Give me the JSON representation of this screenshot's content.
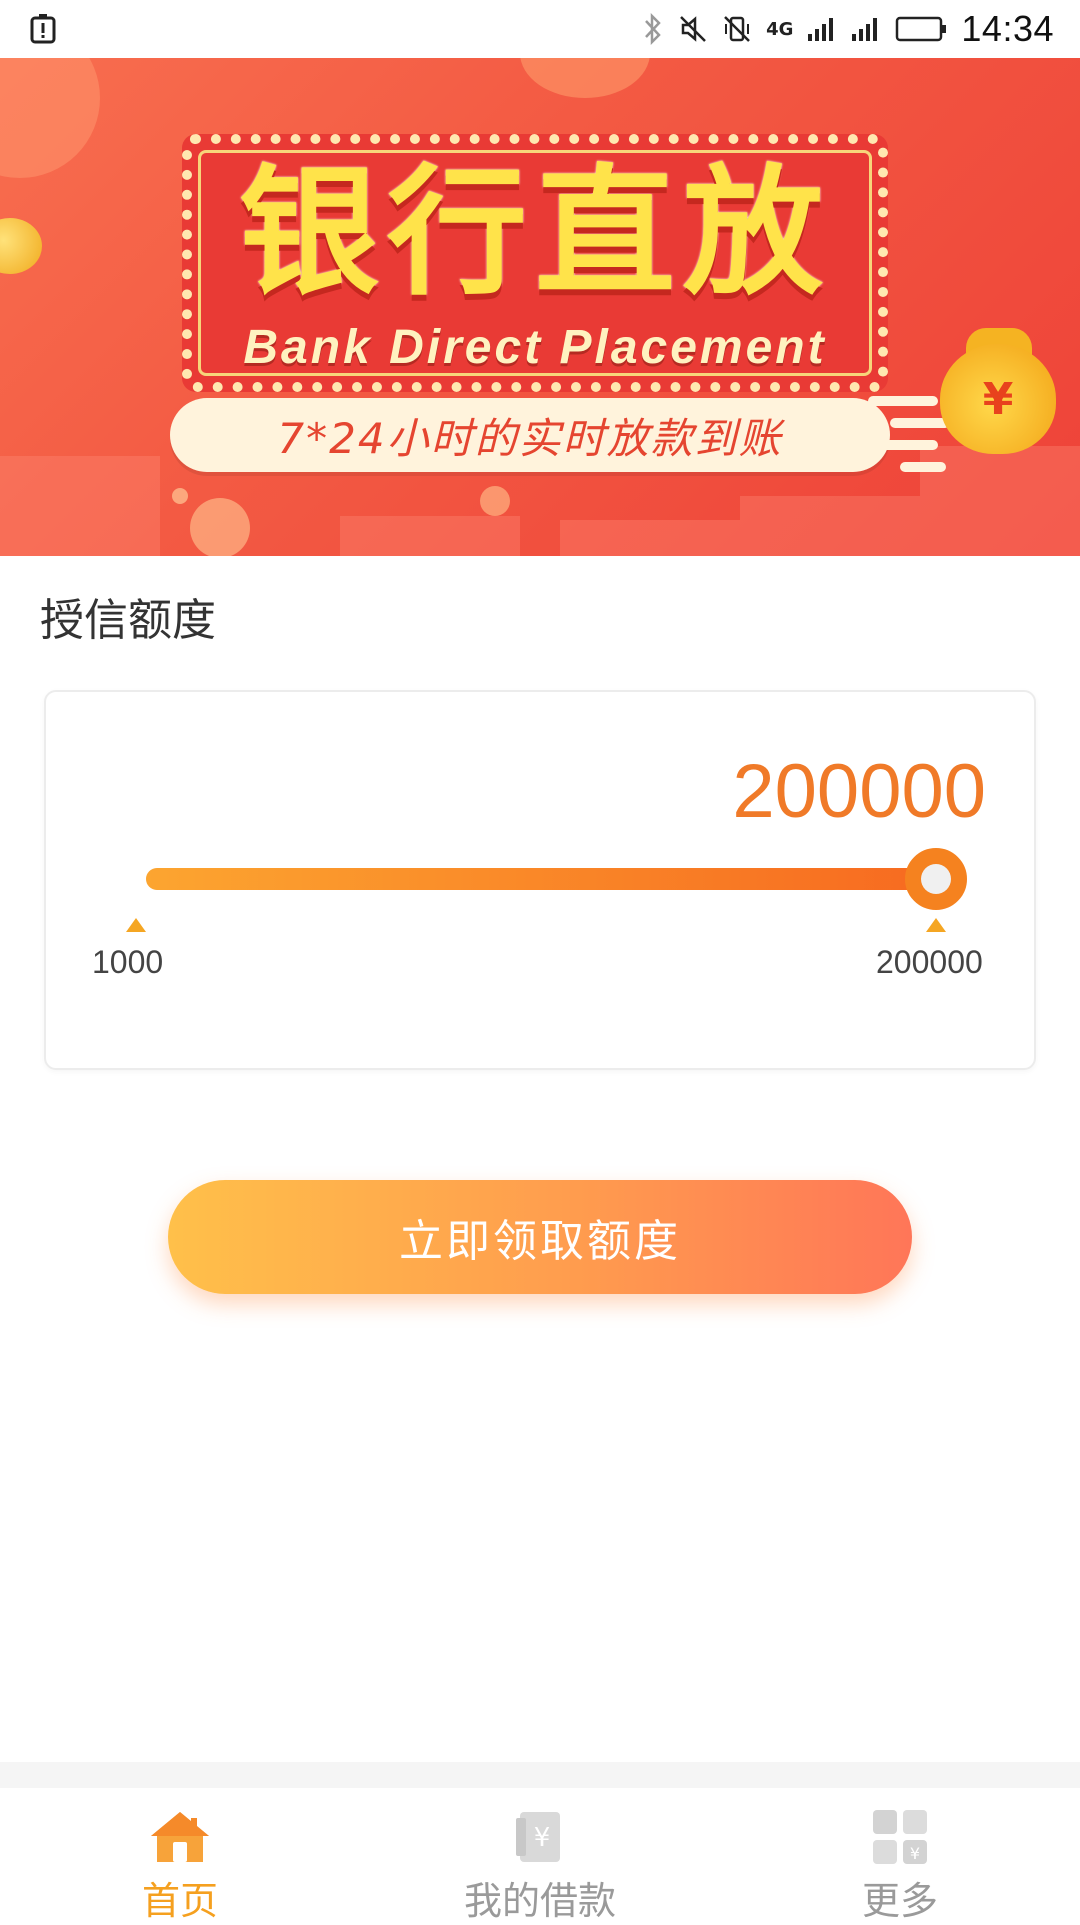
{
  "status_bar": {
    "time": "14:34",
    "network": "4G",
    "icons": [
      "alert-icon",
      "bluetooth-icon",
      "mute-icon",
      "vibrate-off-icon",
      "signal-icon",
      "signal-icon",
      "battery-icon"
    ]
  },
  "banner": {
    "title": "银行直放",
    "subtitle_en": "Bank Direct Placement",
    "tagline": "7*24小时的实时放款到账",
    "currency_symbol": "¥"
  },
  "credit": {
    "section_title": "授信额度",
    "current_amount": "200000",
    "min_label": "1000",
    "max_label": "200000",
    "slider_fraction": 1.0,
    "accent_color": "#f07a28"
  },
  "cta": {
    "label": "立即领取额度"
  },
  "bottom_nav": {
    "items": [
      {
        "label": "首页",
        "icon": "home-icon",
        "active": true
      },
      {
        "label": "我的借款",
        "icon": "wallet-yen-icon",
        "active": false
      },
      {
        "label": "更多",
        "icon": "grid-more-icon",
        "active": false
      }
    ],
    "active_color": "#f5a01f",
    "inactive_color": "#9a9a9a"
  }
}
